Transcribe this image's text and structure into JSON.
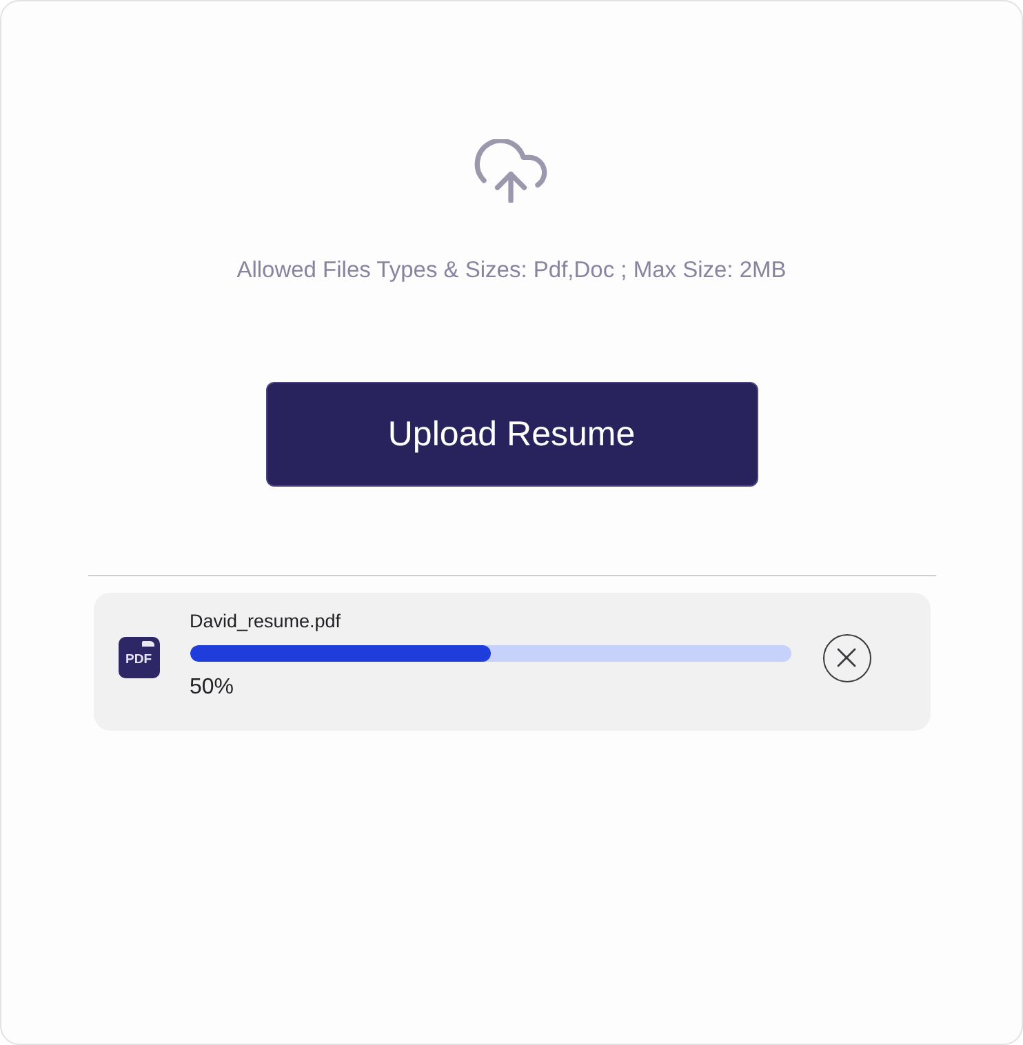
{
  "upload": {
    "hint": "Allowed Files Types & Sizes: Pdf,Doc ; Max Size: 2MB",
    "button": "Upload Resume"
  },
  "files": [
    {
      "kind": "pdf",
      "type_label": "PDF",
      "name": "David_resume.pdf",
      "level": 0.5,
      "percent": "50%"
    }
  ]
}
